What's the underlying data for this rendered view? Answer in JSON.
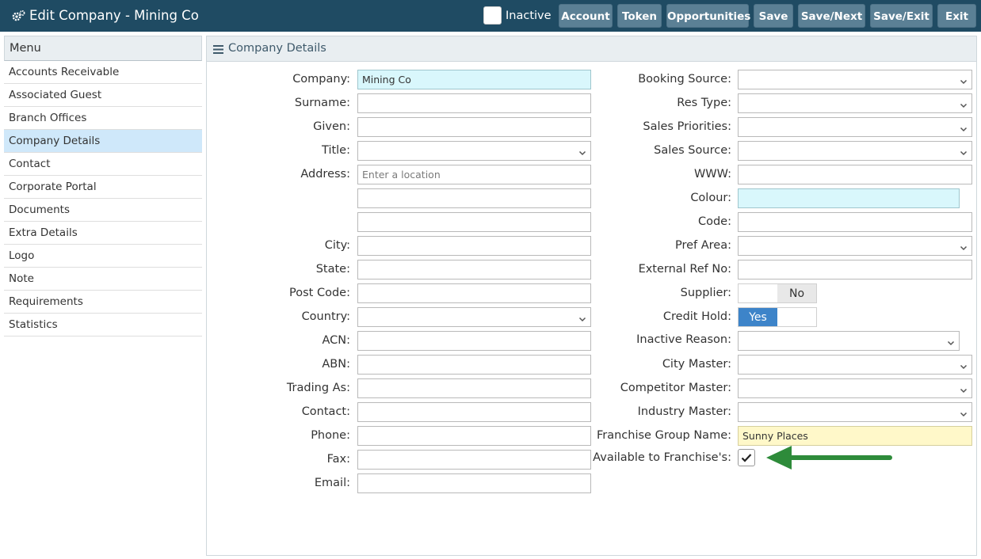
{
  "header": {
    "title": "Edit Company - Mining Co",
    "inactive_label": "Inactive",
    "buttons": [
      "Account",
      "Token",
      "Opportunities",
      "Save",
      "Save/Next",
      "Save/Exit",
      "Exit"
    ]
  },
  "sidebar": {
    "heading": "Menu",
    "items": [
      "Accounts Receivable",
      "Associated Guest",
      "Branch Offices",
      "Company Details",
      "Contact",
      "Corporate Portal",
      "Documents",
      "Extra Details",
      "Logo",
      "Note",
      "Requirements",
      "Statistics"
    ],
    "active": "Company Details"
  },
  "panel": {
    "title": "Company Details"
  },
  "left_form": {
    "company_label": "Company:",
    "company_value": "Mining Co",
    "surname_label": "Surname:",
    "given_label": "Given:",
    "title_label": "Title:",
    "address_label": "Address:",
    "address_placeholder": "Enter a location",
    "city_label": "City:",
    "state_label": "State:",
    "postcode_label": "Post Code:",
    "country_label": "Country:",
    "acn_label": "ACN:",
    "abn_label": "ABN:",
    "trading_as_label": "Trading As:",
    "contact_label": "Contact:",
    "phone_label": "Phone:",
    "fax_label": "Fax:",
    "email_label": "Email:"
  },
  "right_form": {
    "booking_source_label": "Booking Source:",
    "res_type_label": "Res Type:",
    "sales_priorities_label": "Sales Priorities:",
    "sales_source_label": "Sales Source:",
    "www_label": "WWW:",
    "colour_label": "Colour:",
    "code_label": "Code:",
    "pref_area_label": "Pref Area:",
    "external_ref_label": "External Ref No:",
    "supplier_label": "Supplier:",
    "supplier_value": "No",
    "credit_hold_label": "Credit Hold:",
    "credit_hold_value": "Yes",
    "inactive_reason_label": "Inactive Reason:",
    "city_master_label": "City Master:",
    "competitor_master_label": "Competitor Master:",
    "industry_master_label": "Industry Master:",
    "franchise_group_label": "Franchise Group Name:",
    "franchise_group_value": "Sunny Places",
    "available_label": "Available to Franchise's:",
    "available_checked": true
  },
  "colors": {
    "header_bg": "#1f4b63",
    "button_bg": "#5b8095",
    "active_menu_bg": "#cfe8fa",
    "highlight_blue": "#d9f7fc",
    "highlight_yellow": "#fff8c9",
    "toggle_yes": "#3d84c9",
    "arrow_green": "#2e8b3a"
  }
}
